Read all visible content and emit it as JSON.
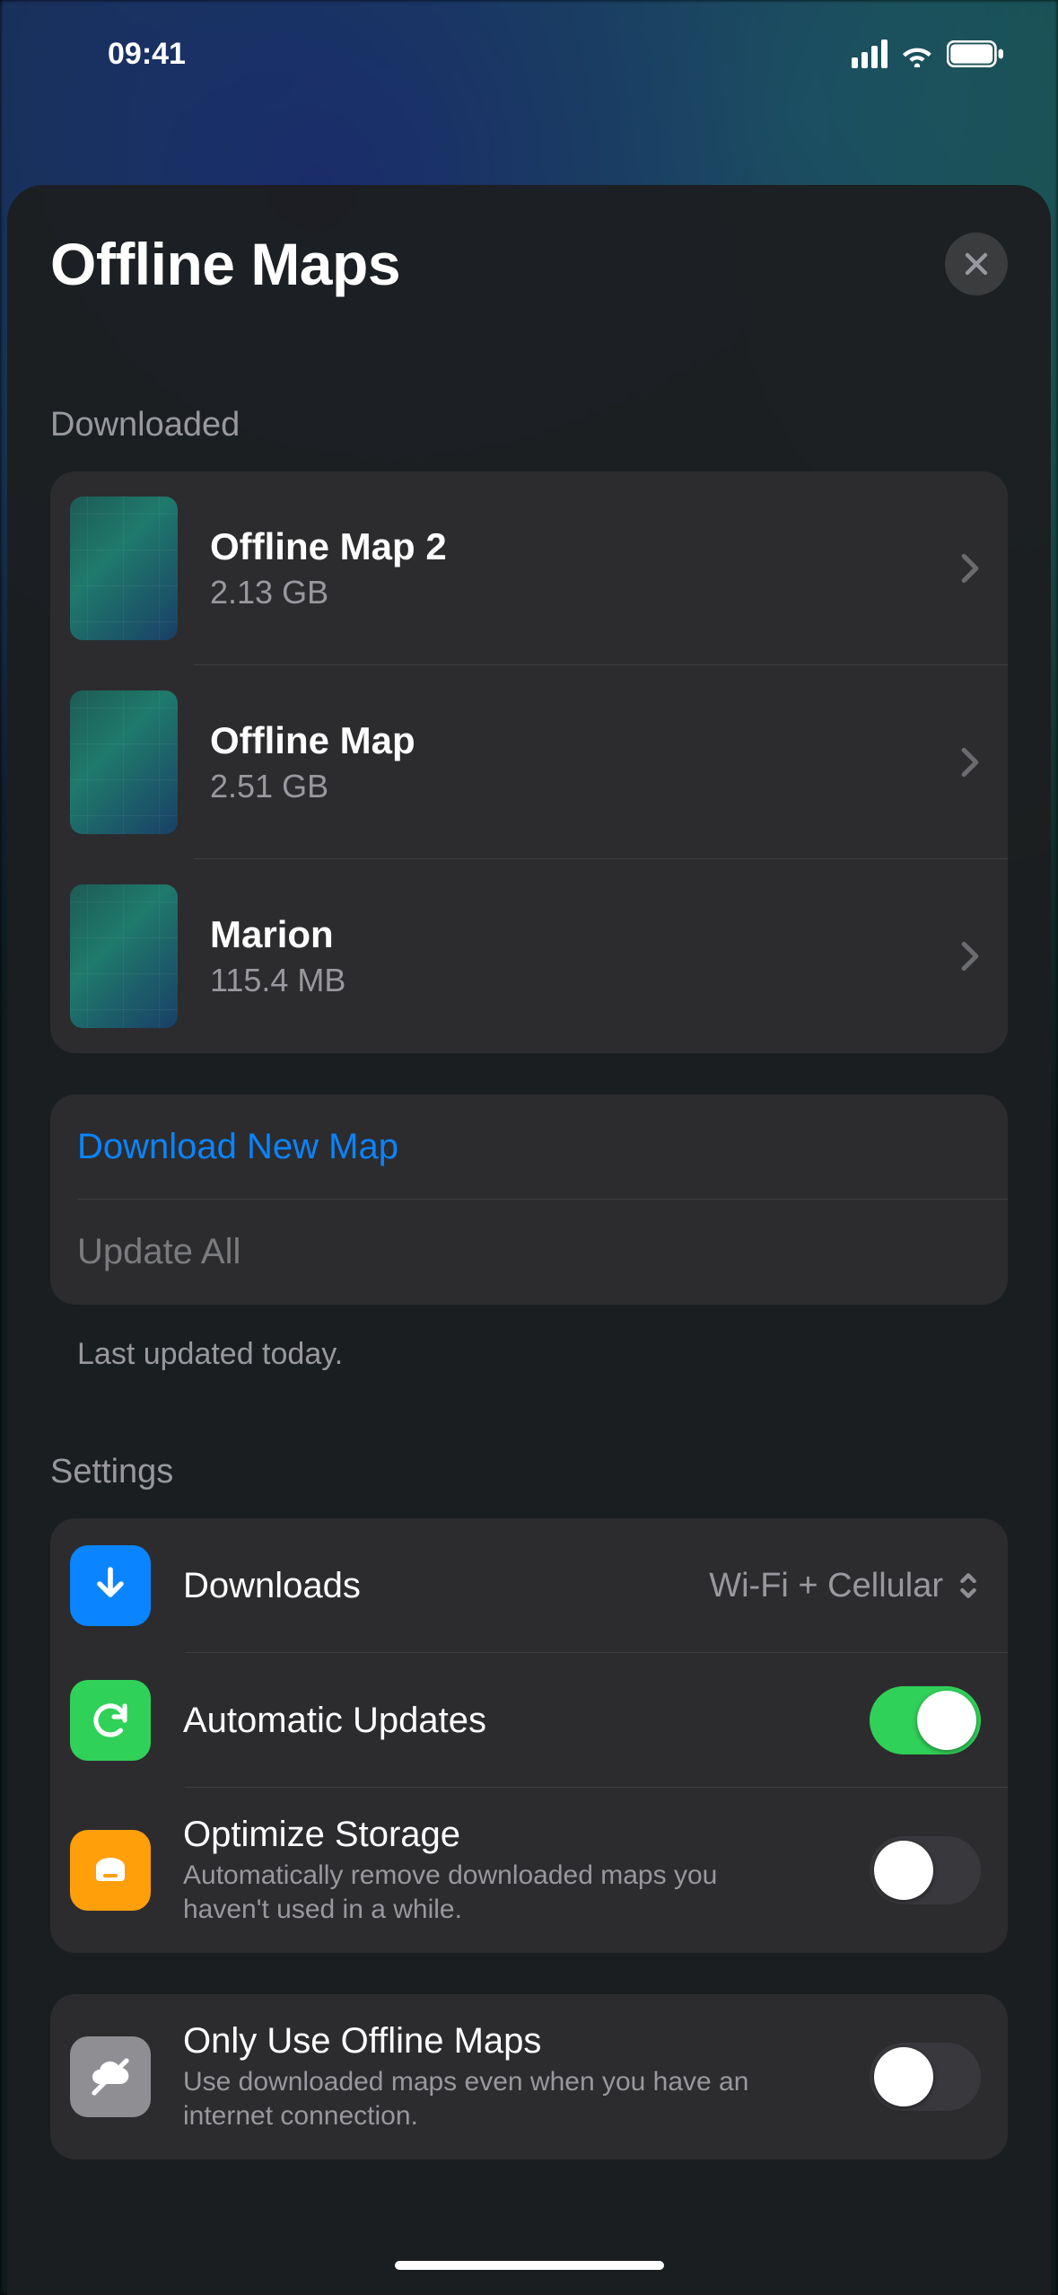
{
  "status": {
    "time": "09:41"
  },
  "sheet": {
    "title": "Offline Maps",
    "section_downloaded": "Downloaded",
    "maps": [
      {
        "name": "Offline Map 2",
        "size": "2.13 GB"
      },
      {
        "name": "Offline Map",
        "size": "2.51 GB"
      },
      {
        "name": "Marion",
        "size": "115.4 MB"
      }
    ],
    "download_new": "Download New Map",
    "update_all": "Update All",
    "last_updated": "Last updated today.",
    "section_settings": "Settings",
    "settings": {
      "downloads": {
        "label": "Downloads",
        "value": "Wi-Fi + Cellular"
      },
      "auto_updates": {
        "label": "Automatic Updates",
        "on": true
      },
      "optimize": {
        "label": "Optimize Storage",
        "sub": "Automatically remove downloaded maps you haven't used in a while.",
        "on": false
      },
      "offline_only": {
        "label": "Only Use Offline Maps",
        "sub": "Use downloaded maps even when you have an internet connection.",
        "on": false
      }
    }
  }
}
